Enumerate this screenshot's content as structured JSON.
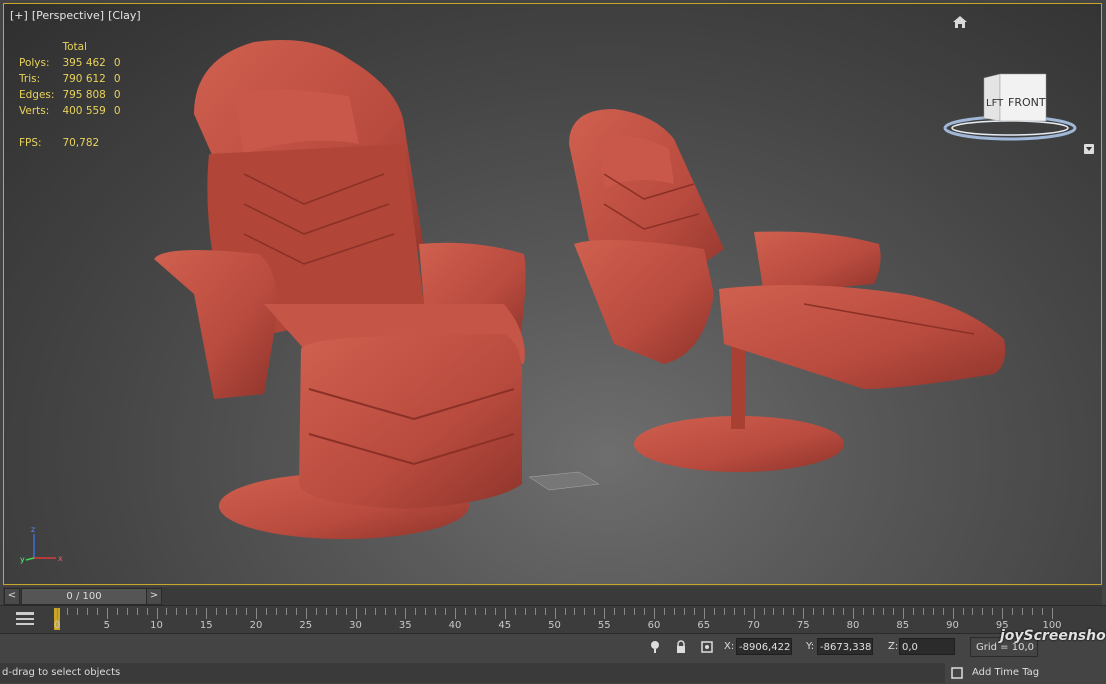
{
  "viewport": {
    "labels": [
      "[+]",
      "[Perspective]",
      "[Clay]"
    ],
    "stats": {
      "header": "Total",
      "rows": [
        {
          "label": "Polys:",
          "total": "395 462",
          "sel": "0"
        },
        {
          "label": "Tris:",
          "total": "790 612",
          "sel": "0"
        },
        {
          "label": "Edges:",
          "total": "795 808",
          "sel": "0"
        },
        {
          "label": "Verts:",
          "total": "400 559",
          "sel": "0"
        }
      ],
      "fps_label": "FPS:",
      "fps_value": "70,782"
    },
    "viewcube": {
      "left_label": "LFT",
      "front_label": "FRONT"
    },
    "axis": {
      "x": "x",
      "y": "y",
      "z": "z"
    },
    "model_color": "#b84a3e"
  },
  "time_slider": {
    "prev": "<",
    "next": ">",
    "position": "0 / 100"
  },
  "trackbar": {
    "ticks": [
      "0",
      "5",
      "10",
      "15",
      "20",
      "25",
      "30",
      "35",
      "40",
      "45",
      "50",
      "55",
      "60",
      "65",
      "70",
      "75",
      "80",
      "85",
      "90",
      "95",
      "100"
    ]
  },
  "status": {
    "x_label": "X:",
    "x_value": "-8906,422",
    "y_label": "Y:",
    "y_value": "-8673,338",
    "z_label": "Z:",
    "z_value": "0,0",
    "grid": "Grid = 10,0",
    "prompt": "d-drag to select objects",
    "add_time_tag": "Add Time Tag"
  },
  "watermark": "joyScreenshot"
}
